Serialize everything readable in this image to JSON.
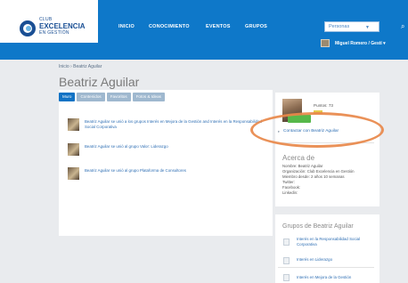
{
  "logo": {
    "line1": "CLUB",
    "line2": "EXCELENCIA",
    "line3": "EN GESTIÓN"
  },
  "nav": {
    "items": [
      "INICIO",
      "CONOCIMIENTO",
      "EVENTOS",
      "GRUPOS"
    ]
  },
  "search": {
    "scope_label": "Personas",
    "scope_arrow": "▼"
  },
  "user": {
    "name": "Miguel Romero / Gestí ▾"
  },
  "breadcrumb": "Inicio › Beatriz Aguilar",
  "profile": {
    "name": "Beatriz Aguilar",
    "tabs": [
      "Muro",
      "Contenidos",
      "Favoritos",
      "Fotos & Ideas"
    ],
    "points_label": "Puntos: 73",
    "contact_link": "Contactar con Beatriz Aguilar",
    "contact_icon": "▸"
  },
  "activity": [
    "Beatriz Aguilar se unió a los grupos Interés en Mejora de la Gestión and Interés en la Responsabilidad Social Corporativa",
    "Beatriz Aguilar se unió al grupo Valor: Liderazgo",
    "Beatriz Aguilar se unió al grupo Plataforma de Consultores"
  ],
  "about": {
    "title": "Acerca de",
    "lines": [
      "Nombre: Beatriz Aguilar",
      "Organización: Club Excelencia en Gestión",
      "Miembro desde: 2 años 10 semanas",
      "Twitter:",
      "Facebook:",
      "Linkedin:"
    ]
  },
  "groups": {
    "title": "Grupos de Beatriz Aguilar",
    "items": [
      "Interés en la Responsabilidad Social Corporativa",
      "Interés en Liderazgo",
      "Interés en Mejora de la Gestión"
    ]
  },
  "colors": {
    "header": "#0e78c9",
    "link": "#2f6fb4",
    "highlight": "#e8884a",
    "follow_button": "#57b84a"
  }
}
